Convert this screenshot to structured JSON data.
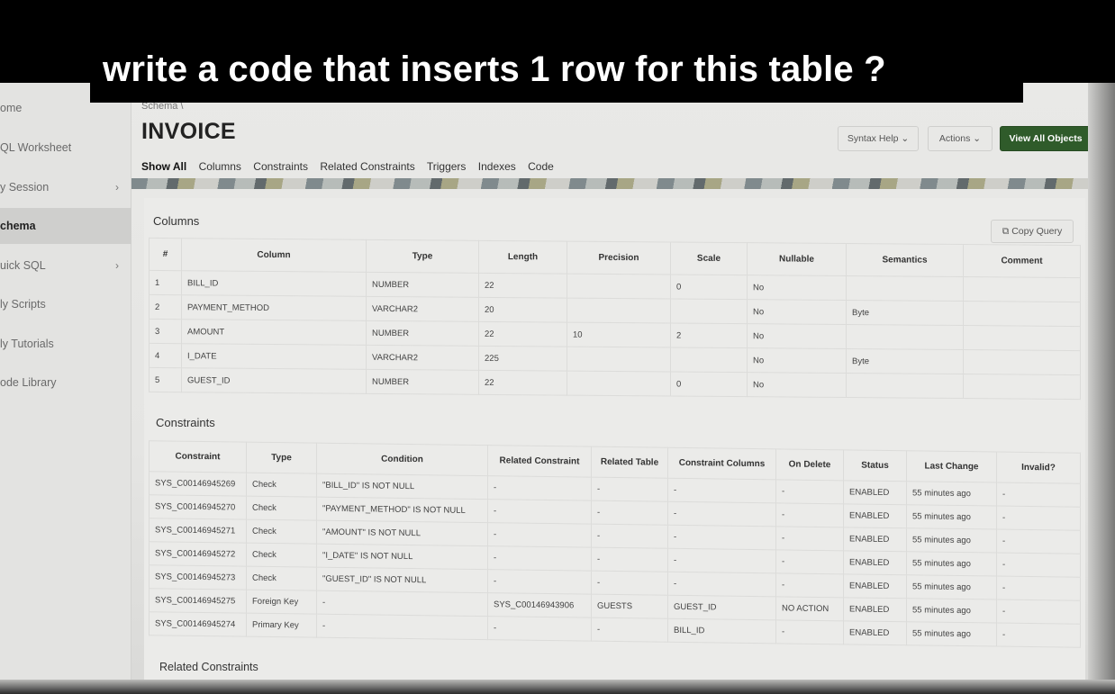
{
  "caption": "write a code that inserts 1 row  for this table  ?",
  "sidebar": {
    "items": [
      {
        "label": "ome",
        "chevron": false,
        "active": false
      },
      {
        "label": "QL Worksheet",
        "chevron": false,
        "active": false
      },
      {
        "label": "y Session",
        "chevron": true,
        "active": false
      },
      {
        "label": "chema",
        "chevron": false,
        "active": true
      },
      {
        "label": "uick SQL",
        "chevron": true,
        "active": false
      },
      {
        "label": "ly Scripts",
        "chevron": false,
        "active": false
      },
      {
        "label": "ly Tutorials",
        "chevron": false,
        "active": false
      },
      {
        "label": "ode Library",
        "chevron": false,
        "active": false
      }
    ]
  },
  "header": {
    "breadcrumb": "Schema  \\",
    "title": "INVOICE",
    "tabs": [
      "Show All",
      "Columns",
      "Constraints",
      "Related Constraints",
      "Triggers",
      "Indexes",
      "Code"
    ],
    "syntax_help": "Syntax Help  ⌄",
    "actions": "Actions  ⌄",
    "view_all": "View All Objects"
  },
  "columns_section": {
    "title": "Columns",
    "copy_query": "Copy Query",
    "headers": [
      "#",
      "Column",
      "Type",
      "Length",
      "Precision",
      "Scale",
      "Nullable",
      "Semantics",
      "Comment"
    ],
    "rows": [
      [
        "1",
        "BILL_ID",
        "NUMBER",
        "22",
        "",
        "0",
        "No",
        "",
        ""
      ],
      [
        "2",
        "PAYMENT_METHOD",
        "VARCHAR2",
        "20",
        "",
        "",
        "No",
        "Byte",
        ""
      ],
      [
        "3",
        "AMOUNT",
        "NUMBER",
        "22",
        "10",
        "2",
        "No",
        "",
        ""
      ],
      [
        "4",
        "I_DATE",
        "VARCHAR2",
        "225",
        "",
        "",
        "No",
        "Byte",
        ""
      ],
      [
        "5",
        "GUEST_ID",
        "NUMBER",
        "22",
        "",
        "0",
        "No",
        "",
        ""
      ]
    ]
  },
  "constraints_section": {
    "title": "Constraints",
    "headers": [
      "Constraint",
      "Type",
      "Condition",
      "Related Constraint",
      "Related Table",
      "Constraint Columns",
      "On Delete",
      "Status",
      "Last Change",
      "Invalid?"
    ],
    "rows": [
      [
        "SYS_C00146945269",
        "Check",
        "\"BILL_ID\" IS NOT NULL",
        "-",
        "-",
        "-",
        "-",
        "ENABLED",
        "55 minutes ago",
        "-"
      ],
      [
        "SYS_C00146945270",
        "Check",
        "\"PAYMENT_METHOD\" IS NOT NULL",
        "-",
        "-",
        "-",
        "-",
        "ENABLED",
        "55 minutes ago",
        "-"
      ],
      [
        "SYS_C00146945271",
        "Check",
        "\"AMOUNT\" IS NOT NULL",
        "-",
        "-",
        "-",
        "-",
        "ENABLED",
        "55 minutes ago",
        "-"
      ],
      [
        "SYS_C00146945272",
        "Check",
        "\"I_DATE\" IS NOT NULL",
        "-",
        "-",
        "-",
        "-",
        "ENABLED",
        "55 minutes ago",
        "-"
      ],
      [
        "SYS_C00146945273",
        "Check",
        "\"GUEST_ID\" IS NOT NULL",
        "-",
        "-",
        "-",
        "-",
        "ENABLED",
        "55 minutes ago",
        "-"
      ],
      [
        "SYS_C00146945275",
        "Foreign Key",
        "-",
        "SYS_C00146943906",
        "GUESTS",
        "GUEST_ID",
        "NO ACTION",
        "ENABLED",
        "55 minutes ago",
        "-"
      ],
      [
        "SYS_C00146945274",
        "Primary Key",
        "-",
        "-",
        "-",
        "BILL_ID",
        "-",
        "ENABLED",
        "55 minutes ago",
        "-"
      ]
    ]
  },
  "related_constraints_title": "Related Constraints",
  "colors": {
    "primary_button": "#2f5b2a",
    "background": "#e9e9e7",
    "caption_bg": "#000000"
  }
}
